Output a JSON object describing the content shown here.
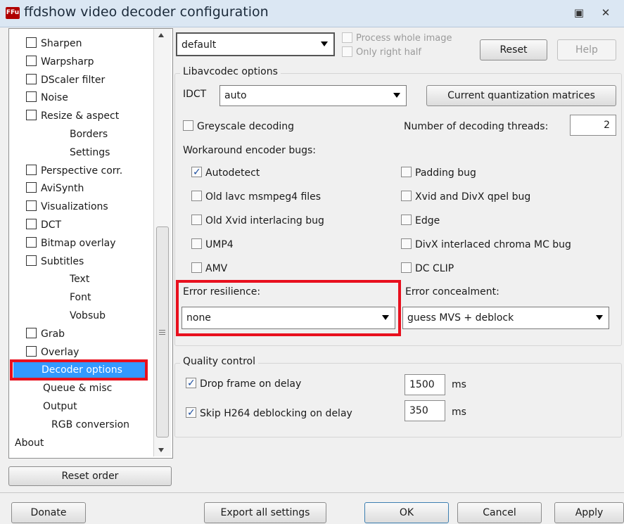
{
  "window": {
    "title": "ffdshow video decoder configuration",
    "icon_text": "FFu"
  },
  "tree": {
    "items": [
      {
        "label": "Sharpen",
        "checkbox": true
      },
      {
        "label": "Warpsharp",
        "checkbox": true
      },
      {
        "label": "DScaler filter",
        "checkbox": true
      },
      {
        "label": "Noise",
        "checkbox": true
      },
      {
        "label": "Resize & aspect",
        "checkbox": true
      },
      {
        "label": "Borders",
        "checkbox": false
      },
      {
        "label": "Settings",
        "checkbox": false
      },
      {
        "label": "Perspective corr.",
        "checkbox": true
      },
      {
        "label": "AviSynth",
        "checkbox": true
      },
      {
        "label": "Visualizations",
        "checkbox": true
      },
      {
        "label": "DCT",
        "checkbox": true
      },
      {
        "label": "Bitmap overlay",
        "checkbox": true
      },
      {
        "label": "Subtitles",
        "checkbox": true
      },
      {
        "label": "Text",
        "checkbox": false
      },
      {
        "label": "Font",
        "checkbox": false
      },
      {
        "label": "Vobsub",
        "checkbox": false
      },
      {
        "label": "Grab",
        "checkbox": true
      },
      {
        "label": "Overlay",
        "checkbox": true
      },
      {
        "label": "Decoder options",
        "checkbox": false,
        "selected": true
      },
      {
        "label": "Queue & misc",
        "checkbox": false
      },
      {
        "label": "Output",
        "checkbox": false
      },
      {
        "label": "RGB conversion",
        "checkbox": false
      },
      {
        "label": "About",
        "checkbox": false
      }
    ],
    "reset_order": "Reset order"
  },
  "top": {
    "preset": "default",
    "process_whole_image": "Process whole image",
    "only_right_half": "Only right half",
    "reset": "Reset",
    "help": "Help"
  },
  "libavcodec": {
    "group_label": "Libavcodec options",
    "idct_label": "IDCT",
    "idct_value": "auto",
    "quant_button": "Current quantization matrices",
    "greyscale": "Greyscale decoding",
    "threads_label": "Number of decoding threads:",
    "threads_value": "2",
    "workaround_label": "Workaround encoder bugs:",
    "bugs_left": [
      {
        "label": "Autodetect",
        "checked": true
      },
      {
        "label": "Old lavc msmpeg4 files",
        "checked": false
      },
      {
        "label": "Old Xvid interlacing bug",
        "checked": false
      },
      {
        "label": "UMP4",
        "checked": false
      },
      {
        "label": "AMV",
        "checked": false
      }
    ],
    "bugs_right": [
      {
        "label": "Padding bug",
        "checked": false
      },
      {
        "label": "Xvid and DivX qpel bug",
        "checked": false
      },
      {
        "label": "Edge",
        "checked": false
      },
      {
        "label": "DivX interlaced chroma MC bug",
        "checked": false
      },
      {
        "label": "DC CLIP",
        "checked": false
      }
    ],
    "error_resilience_label": "Error resilience:",
    "error_resilience_value": "none",
    "error_concealment_label": "Error concealment:",
    "error_concealment_value": "guess MVS + deblock"
  },
  "quality": {
    "group_label": "Quality control",
    "drop_frame": "Drop frame on delay",
    "drop_frame_value": "1500",
    "skip_h264": "Skip H264 deblocking on delay",
    "skip_h264_value": "350",
    "unit": "ms"
  },
  "footer": {
    "donate": "Donate",
    "export": "Export all settings",
    "ok": "OK",
    "cancel": "Cancel",
    "apply": "Apply"
  },
  "colors": {
    "highlight": "#e8101e",
    "selection": "#3399ff"
  }
}
